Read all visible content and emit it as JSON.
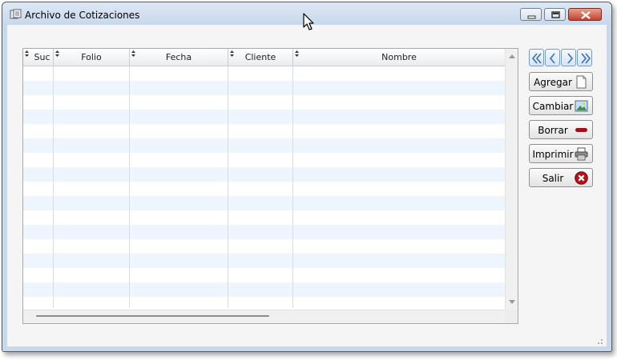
{
  "window": {
    "title": "Archivo de Cotizaciones"
  },
  "grid": {
    "columns": [
      "Suc",
      "Folio",
      "Fecha",
      "Cliente",
      "Nombre"
    ],
    "rows": []
  },
  "navigation": {
    "first_icon": "double-chevron-left-icon",
    "prev_icon": "chevron-left-icon",
    "next_icon": "chevron-right-icon",
    "last_icon": "double-chevron-right-icon"
  },
  "actions": [
    {
      "label": "Agregar",
      "icon": "new-document-icon"
    },
    {
      "label": "Cambiar",
      "icon": "picture-icon"
    },
    {
      "label": "Borrar",
      "icon": "minus-icon"
    },
    {
      "label": "Imprimir",
      "icon": "printer-icon"
    },
    {
      "label": "Salir",
      "icon": "close-circle-icon"
    }
  ],
  "colors": {
    "alt_row": "#eef5fc",
    "close_button": "#c4422b",
    "borrar_icon": "#a0101a",
    "salir_icon": "#b5121b"
  }
}
